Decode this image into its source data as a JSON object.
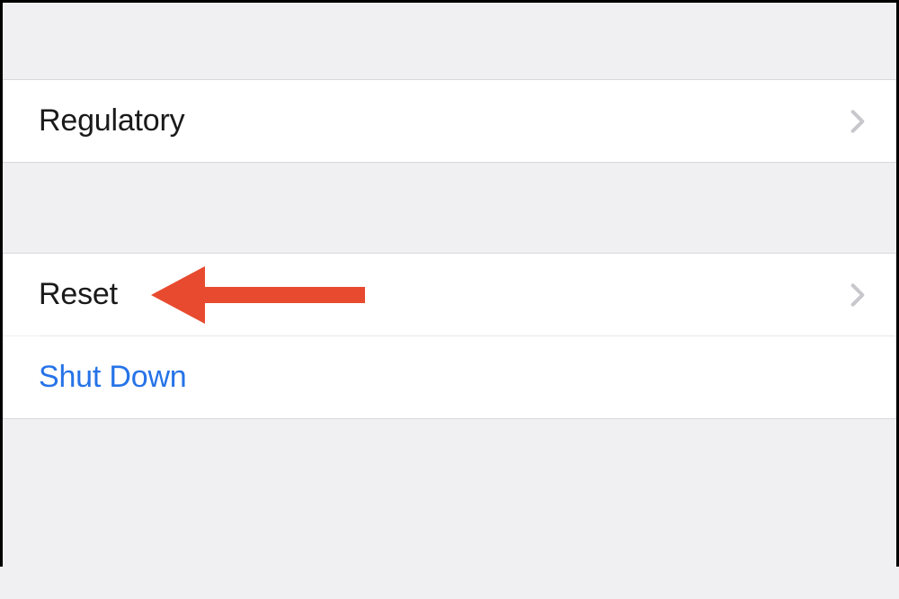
{
  "sections": {
    "first": {
      "regulatory": {
        "label": "Regulatory"
      }
    },
    "second": {
      "reset": {
        "label": "Reset"
      },
      "shutdown": {
        "label": "Shut Down"
      }
    }
  },
  "colors": {
    "link": "#2673e8",
    "arrow": "#e84a2f",
    "chevron": "#c7c7cc"
  }
}
